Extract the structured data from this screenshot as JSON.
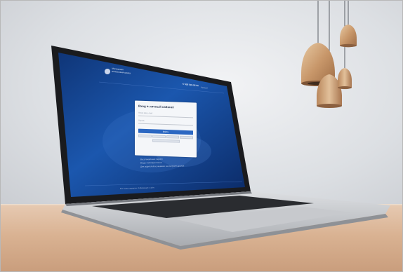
{
  "scene": {
    "description_colors": {
      "wall": "#dcdfe3",
      "desk": "#d9b292",
      "screen_blue": "#1a4fa0",
      "screen_dark": "#0c2a6a",
      "laptop_silver": "#c9cbce",
      "lamp_wood": "#c99a6a"
    }
  },
  "screen": {
    "logo_line1": "Московская",
    "logo_line2": "электронная школа",
    "phone": "+7 495 539-55-55",
    "language": "Русский",
    "login_panel": {
      "title": "Вход в личный кабинет",
      "field_login": "Логин или e-mail",
      "field_password": "Пароль",
      "button": "Войти"
    },
    "links": [
      "Восстановление пароля",
      "Вход с помощью mos.ru",
      "Для родителей и учеников: как получить доступ"
    ],
    "footer": "Все права защищены. Информация о сайте"
  }
}
